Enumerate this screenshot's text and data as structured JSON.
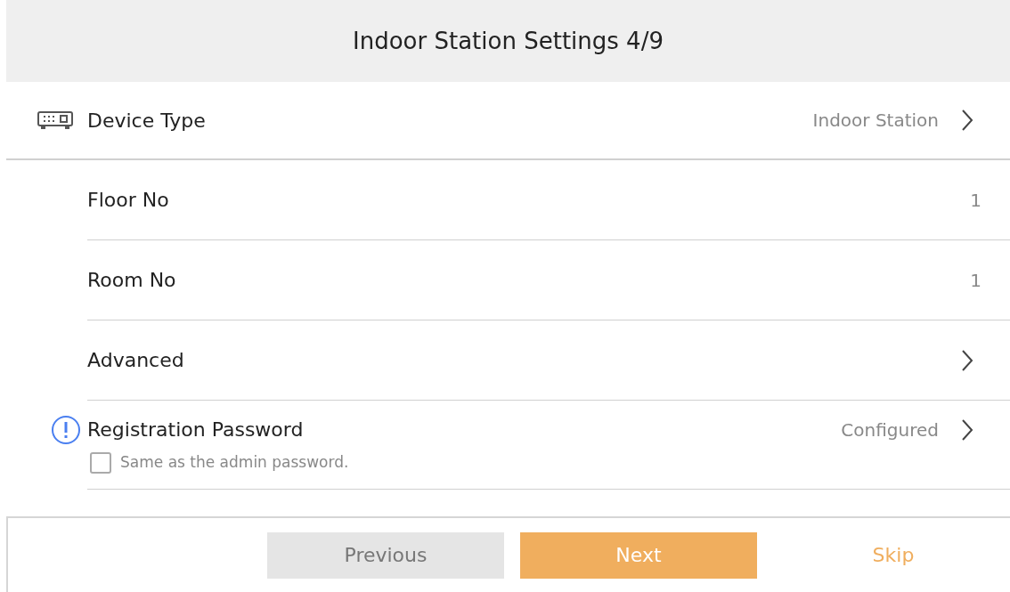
{
  "header": {
    "title": "Indoor Station Settings 4/9"
  },
  "rows": [
    {
      "kind": "link",
      "label": "Device Type",
      "value": "Indoor Station"
    },
    {
      "kind": "value",
      "label": "Floor No",
      "value": "1"
    },
    {
      "kind": "value",
      "label": "Room No",
      "value": "1"
    },
    {
      "kind": "link",
      "label": "Advanced"
    },
    {
      "kind": "link",
      "label": "Registration Password",
      "value": "Configured",
      "checkbox": {
        "label": "Same as the admin password.",
        "checked": false
      }
    }
  ],
  "buttons": [
    {
      "kind": "secondary",
      "label": "Previous"
    },
    {
      "kind": "primary",
      "label": "Next"
    },
    {
      "kind": "text",
      "label": "Skip"
    }
  ]
}
